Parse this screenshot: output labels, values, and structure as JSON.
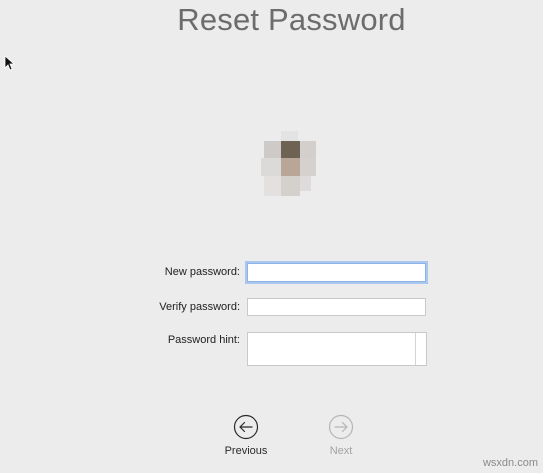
{
  "page": {
    "title": "Reset Password"
  },
  "form": {
    "new_password_label": "New password:",
    "verify_password_label": "Verify password:",
    "password_hint_label": "Password hint:",
    "new_password_value": "",
    "verify_password_value": "",
    "password_hint_value": ""
  },
  "navigation": {
    "previous_label": "Previous",
    "next_label": "Next",
    "next_enabled": false
  },
  "watermark": "wsxdn.com",
  "icons": {
    "cursor": "arrow-cursor-icon",
    "avatar": "user-avatar",
    "previous": "arrow-left-circle-icon",
    "next": "arrow-right-circle-icon"
  },
  "colors": {
    "background": "#ececec",
    "title": "#6c6c6c",
    "focus_ring": "#8eb4e6",
    "disabled": "#a3a3a3"
  }
}
